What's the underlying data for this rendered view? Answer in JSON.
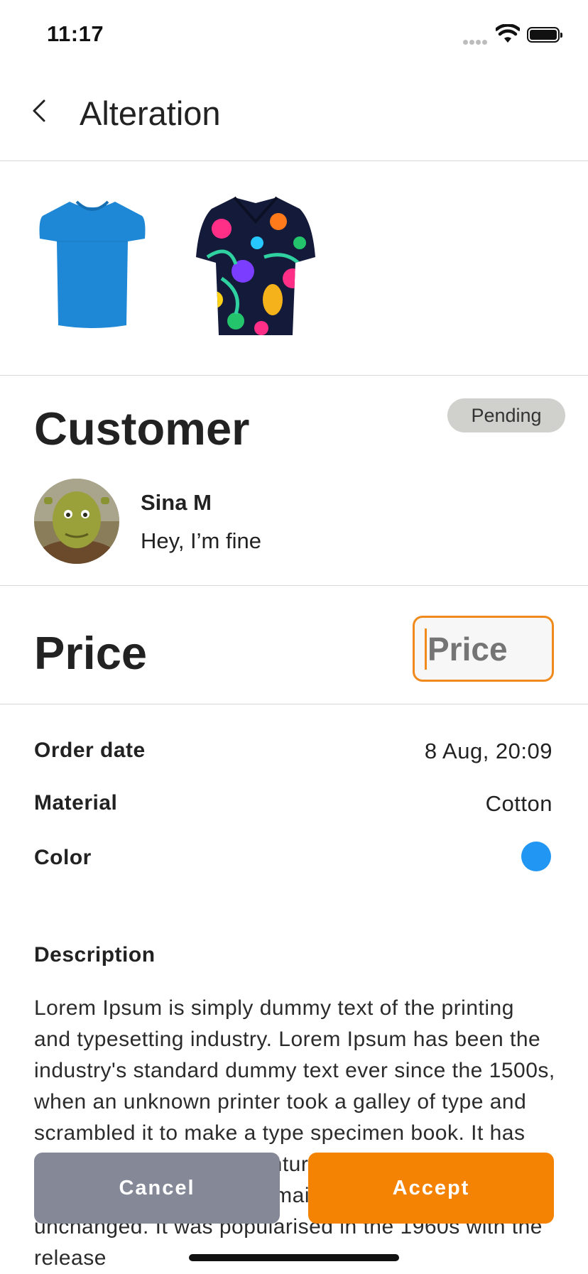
{
  "status_bar": {
    "time": "11:17"
  },
  "header": {
    "title": "Alteration"
  },
  "products": [
    {
      "name": "blue-tshirt",
      "color": "#1e88d6"
    },
    {
      "name": "floral-hawaiian-shirt",
      "color": "#141b3a"
    }
  ],
  "customer": {
    "section_title": "Customer",
    "status": "Pending",
    "name": "Sina M",
    "message": "Hey, I’m fine"
  },
  "price": {
    "section_title": "Price",
    "input_placeholder": "Price",
    "input_value": ""
  },
  "details": {
    "order_date_label": "Order date",
    "order_date_value": "8 Aug, 20:09",
    "material_label": "Material",
    "material_value": "Cotton",
    "color_label": "Color",
    "color_value": "#2196f3"
  },
  "description": {
    "label": "Description",
    "text": "Lorem Ipsum is simply dummy text of the printing and typesetting industry. Lorem Ipsum has been the industry's standard dummy text ever since the 1500s, when an unknown printer took a galley of type and scrambled it to make a type specimen book. It has survived not only five centuries, but also the leap into electronic typesetting, remaining essentially unchanged. It was popularised in the 1960s with the release"
  },
  "actions": {
    "cancel_label": "Cancel",
    "accept_label": "Accept"
  },
  "colors": {
    "accent": "#f58303",
    "cancel": "#848897",
    "badge": "#d0d0cc"
  }
}
